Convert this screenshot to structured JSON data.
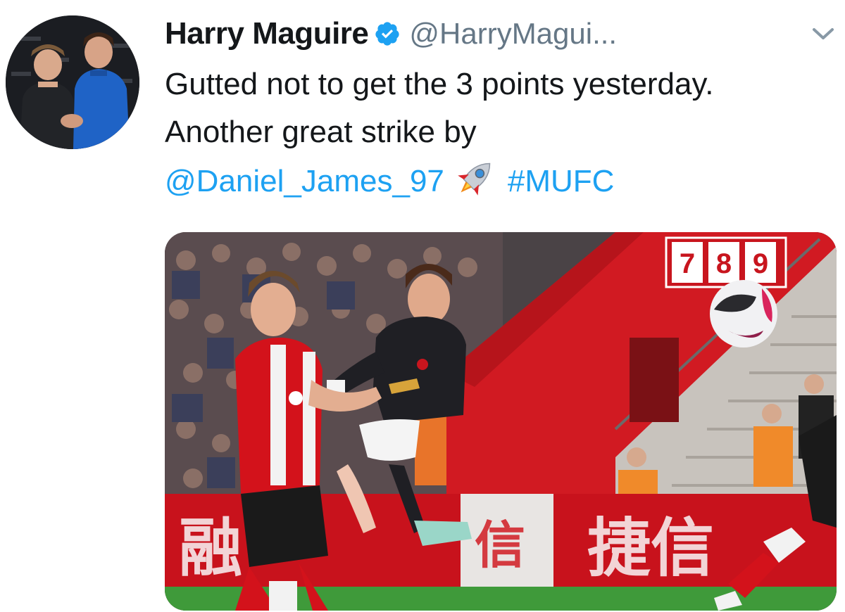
{
  "tweet": {
    "display_name": "Harry Maguire",
    "handle": "@HarryMagui...",
    "text_line1": "Gutted not to get the 3 points yesterday.",
    "text_line2": "Another great strike by",
    "mention": "@Daniel_James_97",
    "hashtag": "#MUFC",
    "emoji": "rocket-emoji"
  },
  "media": {
    "scoreboard_digits": [
      "7",
      "8",
      "9"
    ],
    "board_text": "捷信"
  },
  "colors": {
    "link": "#1da1f2",
    "handle": "#657786",
    "verified": "#1da1f2",
    "caret": "#8899a6"
  },
  "icons": [
    "verified-badge-icon",
    "chevron-down-icon",
    "rocket-emoji"
  ]
}
